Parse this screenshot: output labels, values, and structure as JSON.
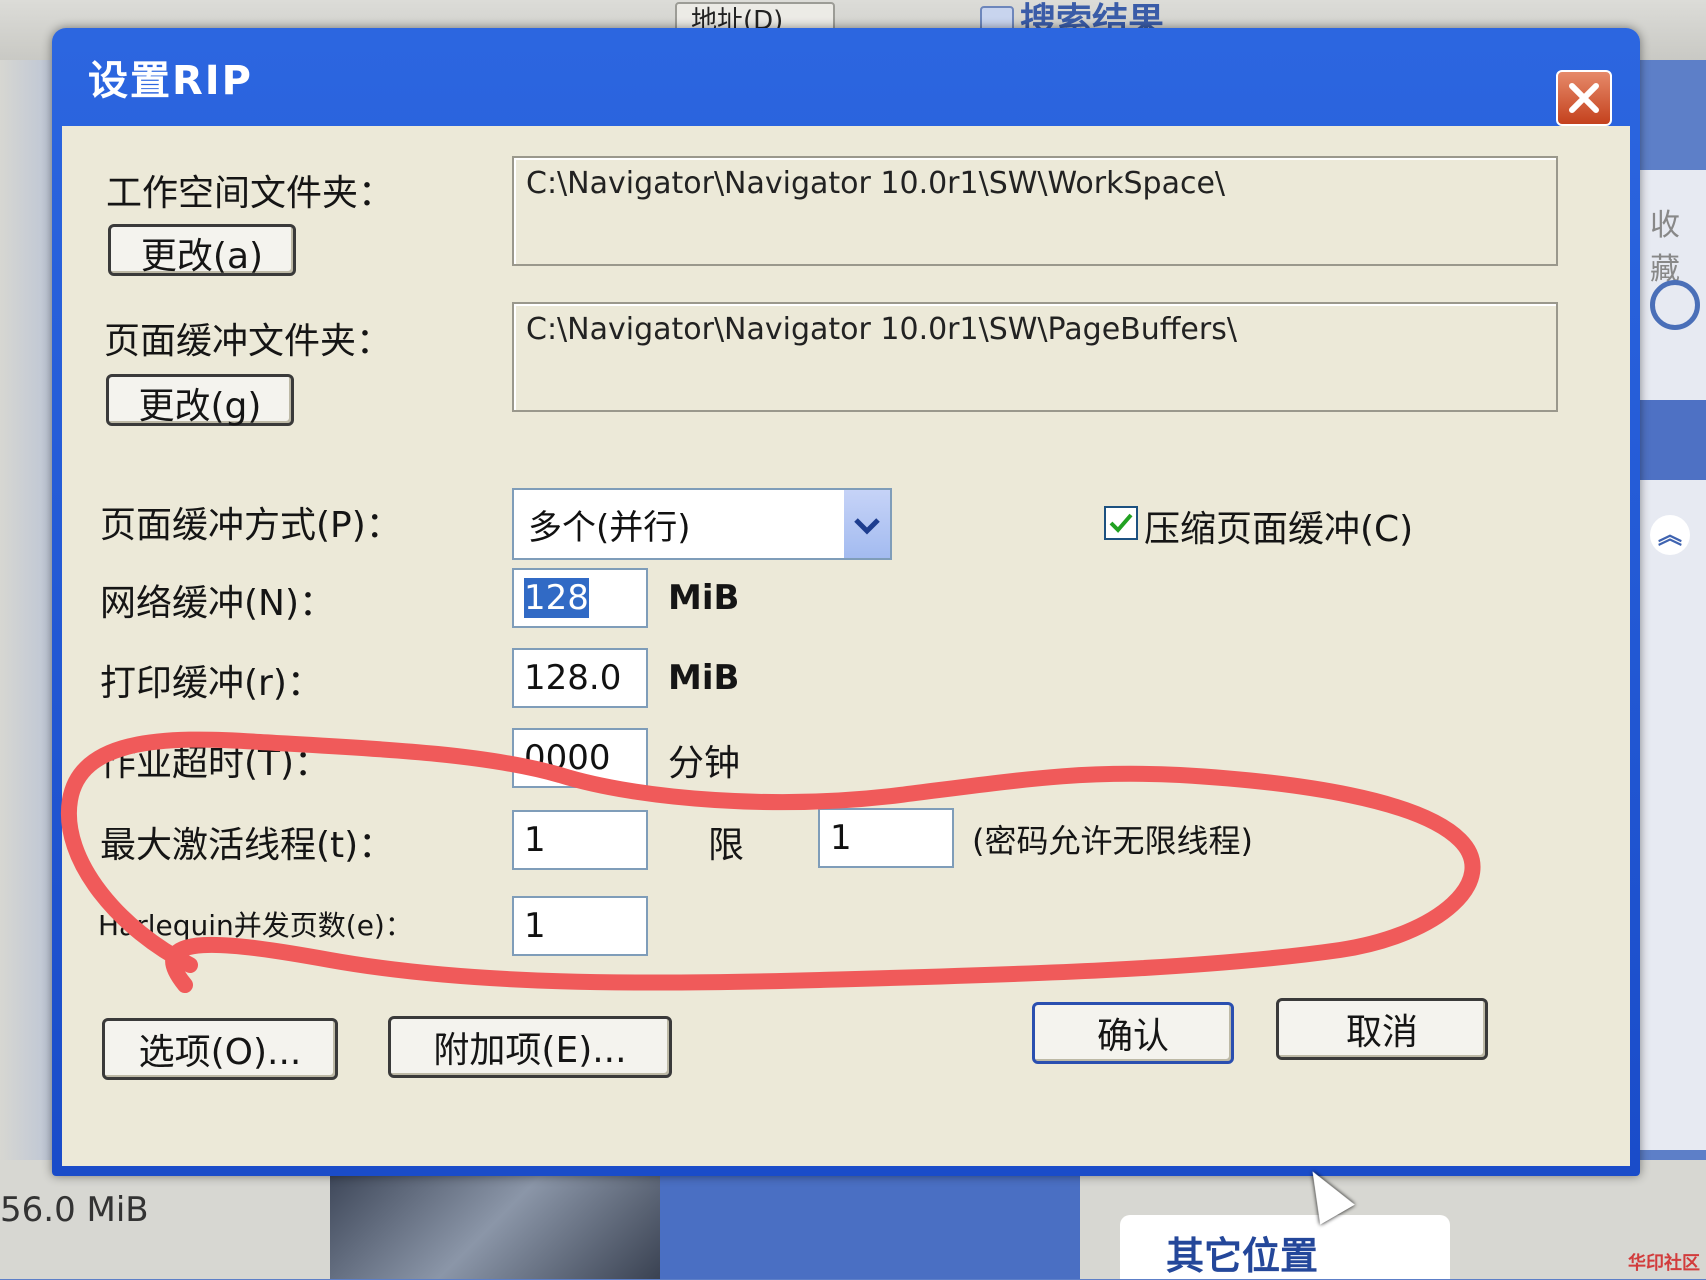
{
  "background": {
    "address_label": "地址(D)",
    "search_results_label": "搜索结果",
    "favorites_label": "收藏",
    "bottom_size": "56.0 MiB",
    "other_places": "其它位置",
    "watermark": "华印社区"
  },
  "dialog": {
    "title": "设置RIP",
    "workspace": {
      "label": "工作空间文件夹：",
      "change_button": "更改(a)",
      "path": "C:\\Navigator\\Navigator 10.0r1\\SW\\WorkSpace\\"
    },
    "page_buffer_folder": {
      "label": "页面缓冲文件夹：",
      "change_button": "更改(g)",
      "path": "C:\\Navigator\\Navigator 10.0r1\\SW\\PageBuffers\\"
    },
    "page_buffer_mode": {
      "label": "页面缓冲方式(P)：",
      "value": "多个(并行)"
    },
    "compress_buffer": {
      "label": "压缩页面缓冲(C)",
      "checked": true
    },
    "network_buffer": {
      "label": "网络缓冲(N)：",
      "value": "128",
      "unit": "MiB"
    },
    "print_buffer": {
      "label": "打印缓冲(r)：",
      "value": "128.0",
      "unit": "MiB"
    },
    "job_timeout": {
      "label": "作业超时(T)：",
      "value": "0000",
      "unit": "分钟"
    },
    "max_threads": {
      "label": "最大激活线程(t)：",
      "value": "1",
      "limit_label": "限",
      "limit_value": "1",
      "note": "(密码允许无限线程)"
    },
    "harlequin": {
      "label": "Harlequin并发页数(e)：",
      "value": "1"
    },
    "buttons": {
      "options": "选项(O)...",
      "addons": "附加项(E)...",
      "ok": "确认",
      "cancel": "取消"
    }
  },
  "colors": {
    "title_bar": "#2c66e0",
    "dialog_face": "#ece9d8",
    "annotation": "#f05a5a",
    "selection": "#316ac5"
  }
}
